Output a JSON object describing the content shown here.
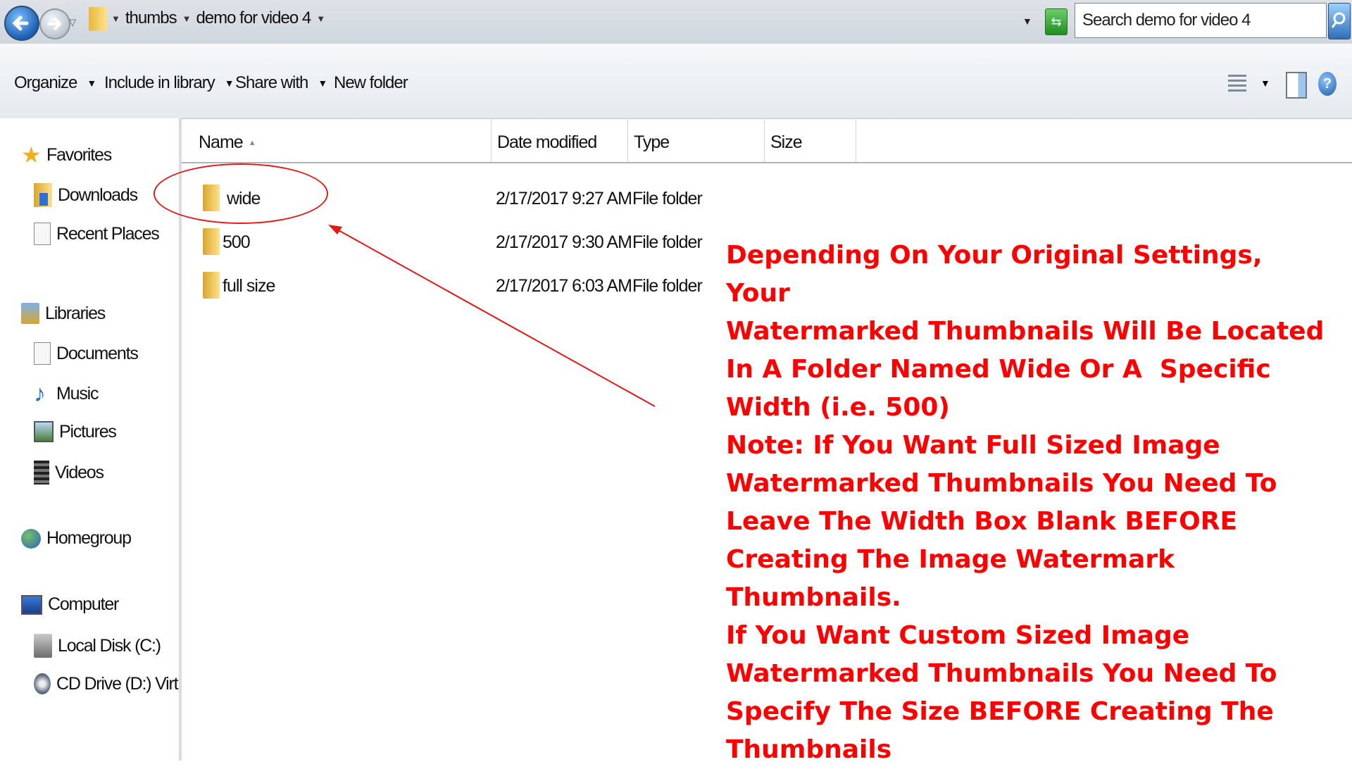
{
  "address_bar": {
    "breadcrumb": [
      "thumbs",
      "demo for video 4"
    ],
    "search_placeholder": "Search demo for video 4"
  },
  "toolbar": {
    "organize": "Organize",
    "include_in_library": "Include in library",
    "share_with": "Share with",
    "new_folder": "New folder"
  },
  "sidebar": {
    "favorites": "Favorites",
    "downloads": "Downloads",
    "recent_places": "Recent Places",
    "libraries": "Libraries",
    "documents": "Documents",
    "music": "Music",
    "pictures": "Pictures",
    "videos": "Videos",
    "homegroup": "Homegroup",
    "computer": "Computer",
    "local_disk": "Local Disk (C:)",
    "cd_drive": "CD Drive (D:) VirtualBo"
  },
  "columns": {
    "name": "Name",
    "date_modified": "Date modified",
    "type": "Type",
    "size": "Size"
  },
  "files": [
    {
      "name": "wide",
      "date": "2/17/2017 9:27 AM",
      "type": "File folder"
    },
    {
      "name": "500",
      "date": "2/17/2017 9:30 AM",
      "type": "File folder"
    },
    {
      "name": "full size",
      "date": "2/17/2017 6:03 AM",
      "type": "File folder"
    }
  ],
  "annotation": {
    "color": "#ff0000",
    "para1": [
      "Depending On Your Original Settings, Your",
      "Watermarked Thumbnails Will Be Located",
      "In A Folder Named Wide Or A  Specific",
      "Width (i.e. 500)"
    ],
    "para2": [
      "Note: If You Want Full Sized Image",
      "Watermarked Thumbnails You Need To",
      "Leave The Width Box Blank BEFORE",
      "Creating The Image Watermark Thumbnails."
    ],
    "para3": [
      "If You Want Custom Sized Image",
      "Watermarked Thumbnails You Need To",
      "Specify The Size BEFORE Creating The",
      "Thumbnails"
    ]
  }
}
